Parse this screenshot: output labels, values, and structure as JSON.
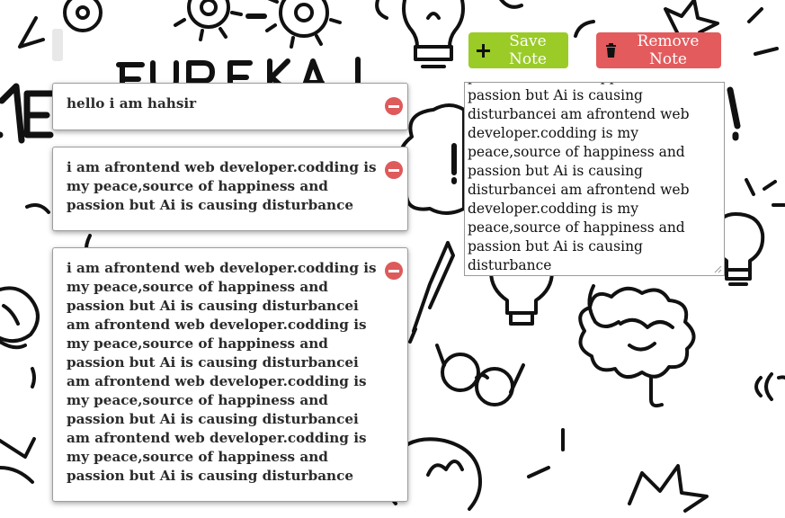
{
  "toolbar": {
    "save_label": "Save Note",
    "remove_label": "Remove Note",
    "save_color": "#9acb27",
    "remove_color": "#e35b5d",
    "save_icon": "plus-icon",
    "remove_icon": "trash-icon"
  },
  "notes": [
    {
      "text": "hello i am hahsir"
    },
    {
      "text": "i am afrontend web developer.codding is my peace,source of happiness and passion but Ai is causing disturbance"
    },
    {
      "text": "i am afrontend web developer.codding is my peace,source of happiness and passion but Ai is causing disturbancei am afrontend web developer.codding is my peace,source of happiness and passion but Ai is causing disturbancei am afrontend web developer.codding is my peace,source of happiness and passion but Ai is causing disturbancei am afrontend web developer.codding is my peace,source of happiness and passion but Ai is causing disturbance"
    }
  ],
  "editor": {
    "value": "i am afrontend web developer.codding is my peace,source of happiness and passion but Ai is causing disturbancei am afrontend web developer.codding is my peace,source of happiness and passion but Ai is causing disturbancei am afrontend web developer.codding is my peace,source of happiness and passion but Ai is causing disturbancei am afrontend web developer.codding is my peace,source of happiness and passion but Ai is causing disturbance"
  },
  "background": {
    "doodle_text": "EUREKA!",
    "delete_icon": "minus-circle-icon",
    "delete_color": "#de5a5b"
  }
}
